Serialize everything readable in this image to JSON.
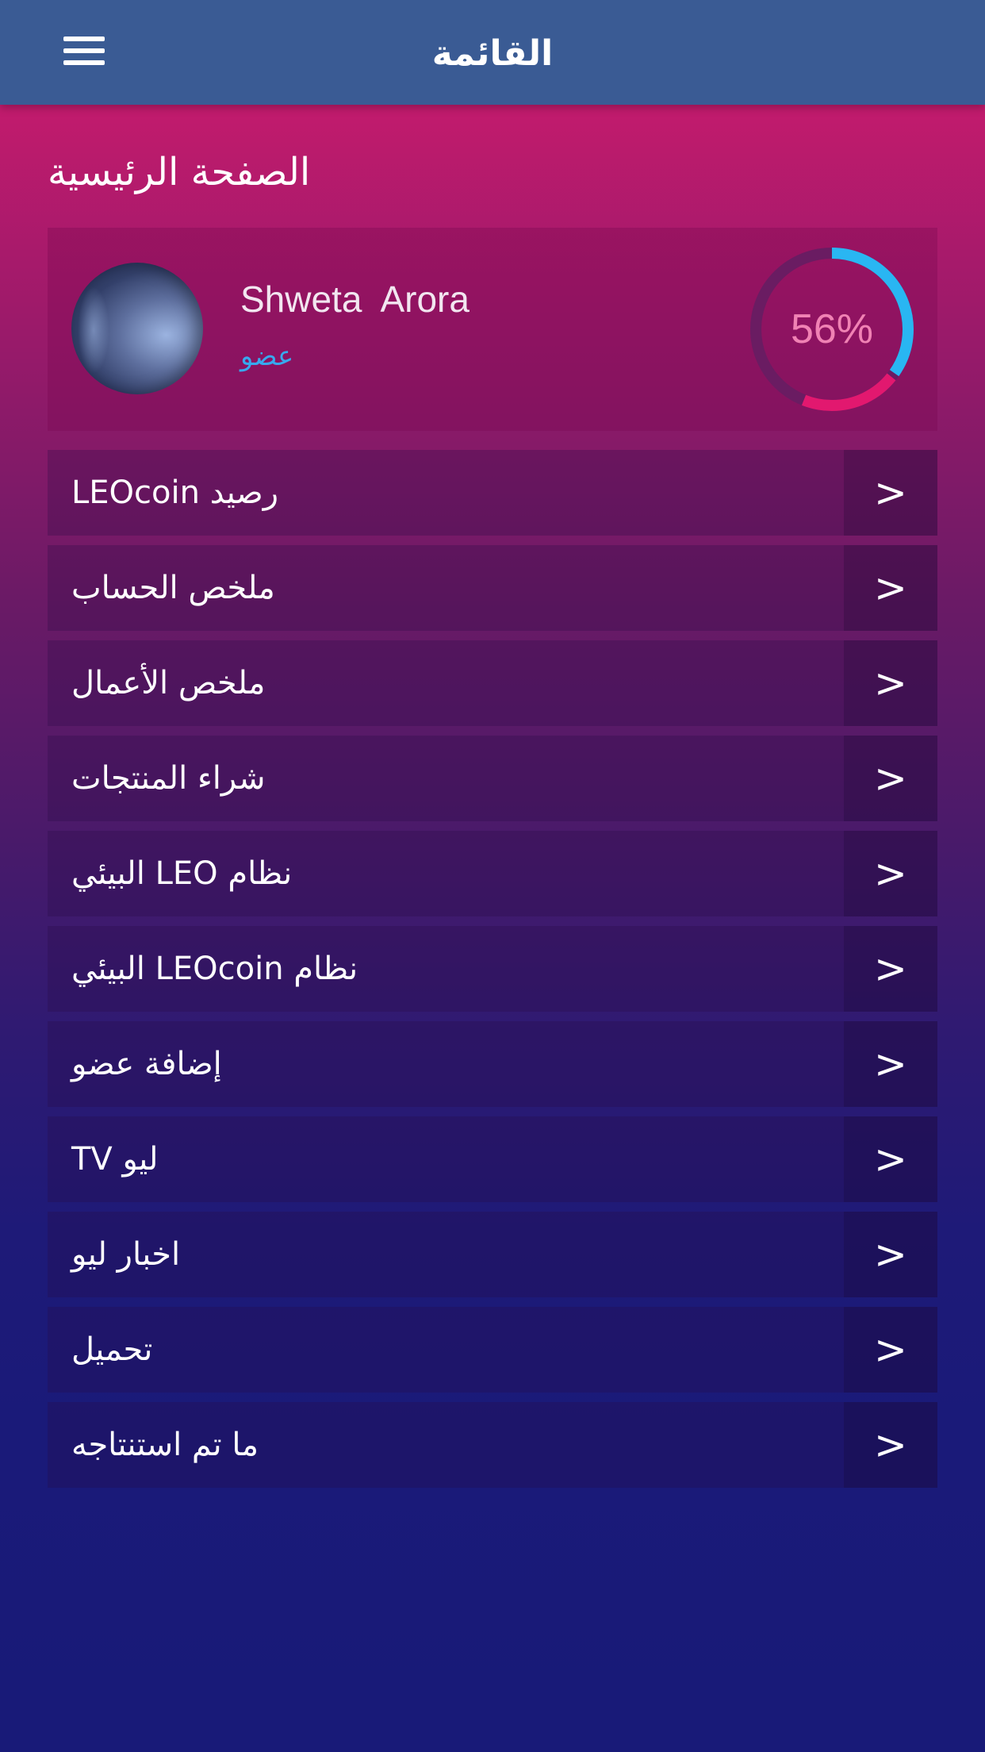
{
  "header": {
    "title": "القائمة",
    "menu_icon": "hamburger-menu-icon"
  },
  "page": {
    "title": "الصفحة الرئيسية"
  },
  "profile": {
    "name": "Shweta  Arora",
    "role": "عضو",
    "progress_percent": 56,
    "progress_label": "56%",
    "colors": {
      "role_text": "#37a9ee",
      "ring_blue": "#29b6f2",
      "ring_pink": "#e2186f",
      "ring_track": "#6a1c62",
      "percent_text": "#f082b4"
    }
  },
  "menu": {
    "items": [
      {
        "label": "LEOcoin رصيد",
        "arrow": ">"
      },
      {
        "label": "ملخص الحساب",
        "arrow": ">"
      },
      {
        "label": "ملخص الأعمال",
        "arrow": ">"
      },
      {
        "label": "شراء المنتجات",
        "arrow": ">"
      },
      {
        "label": "نظام LEO البيئي",
        "arrow": ">"
      },
      {
        "label": "نظام LEOcoin البيئي",
        "arrow": ">"
      },
      {
        "label": "إضافة عضو",
        "arrow": ">"
      },
      {
        "label": "ليو TV",
        "arrow": ">"
      },
      {
        "label": "اخبار ليو",
        "arrow": ">"
      },
      {
        "label": "تحميل",
        "arrow": ">"
      },
      {
        "label": "ما تم استنتاجه",
        "arrow": ">"
      }
    ]
  },
  "theme": {
    "header_bg": "#3a5b94",
    "gradient_top": "#c81a6e",
    "gradient_bottom": "#181a78"
  }
}
